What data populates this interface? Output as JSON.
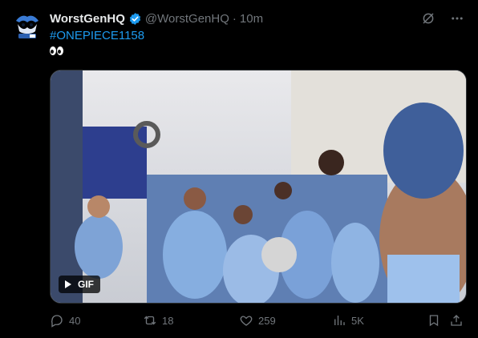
{
  "tweet": {
    "author_name": "WorstGenHQ",
    "handle": "@WorstGenHQ",
    "separator": "·",
    "time": "10m",
    "hashtag": "#ONEPIECE1158",
    "emoji_label": "eyes emoji",
    "media": {
      "type": "gif",
      "badge_label": "GIF"
    },
    "actions": {
      "replies": "40",
      "reposts": "18",
      "likes": "259",
      "views": "5K"
    }
  },
  "icons": {
    "verified": "verified-badge-icon",
    "grok": "grok-icon",
    "more": "more-icon",
    "reply": "reply-icon",
    "repost": "repost-icon",
    "like": "like-icon",
    "views": "views-icon",
    "bookmark": "bookmark-icon",
    "share": "share-icon"
  },
  "colors": {
    "background": "#000000",
    "text_primary": "#e7e9ea",
    "text_secondary": "#71767b",
    "accent": "#1d9bf0"
  }
}
